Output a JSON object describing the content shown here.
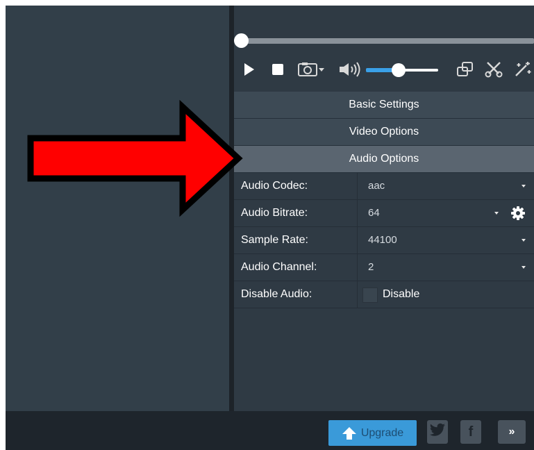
{
  "sections": {
    "basic": "Basic Settings",
    "video": "Video Options",
    "audio": "Audio Options"
  },
  "audio_settings": [
    {
      "label": "Audio Codec:",
      "value": "aac"
    },
    {
      "label": "Audio Bitrate:",
      "value": "64"
    },
    {
      "label": "Sample Rate:",
      "value": "44100"
    },
    {
      "label": "Audio Channel:",
      "value": "2"
    }
  ],
  "disable_audio": {
    "label": "Disable Audio:",
    "checkbox_label": "Disable",
    "checked": false
  },
  "player": {
    "seek_position": 0.0,
    "volume_level": 0.45
  },
  "footer": {
    "upgrade_label": "Upgrade",
    "twitter_glyph": "t",
    "facebook_glyph": "f",
    "more_glyph": "»"
  },
  "icons": [
    "play-icon",
    "stop-icon",
    "camera-icon",
    "volume-icon",
    "copy-icon",
    "scissors-icon",
    "magic-wand-icon",
    "gear-icon",
    "upload-arrow-icon",
    "twitter-icon",
    "facebook-icon"
  ],
  "colors": {
    "accent": "#3a9ad9",
    "annotation_arrow": "#ff0000"
  }
}
